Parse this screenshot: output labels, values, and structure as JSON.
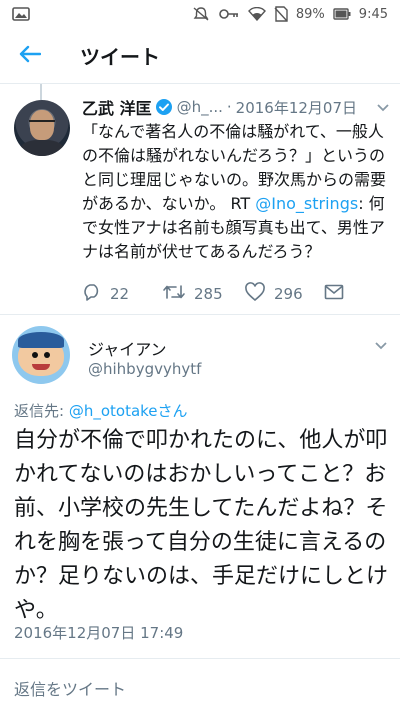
{
  "status_bar": {
    "battery": "89%",
    "time": "9:45",
    "icons": [
      "image-icon",
      "mute-icon",
      "key-icon",
      "wifi-icon",
      "no-sim-icon",
      "battery-icon"
    ]
  },
  "app_bar": {
    "title": "ツイート"
  },
  "parent_tweet": {
    "name": "乙武 洋匡",
    "handle": "@h_...",
    "separator": "·",
    "date": "2016年12月07日",
    "text_part1": "「なんで著名人の不倫は騒がれて、一般人の不倫は騒がれないんだろう？」というのと同じ理屈じゃないの。野次馬からの需要があるか、ないか。 RT ",
    "mention": "@Ino_strings",
    "text_part2": ": 何で女性アナは名前も顔写真も出て、男性アナは名前が伏せてあるんだろう？",
    "reply_count": "22",
    "retweet_count": "285",
    "like_count": "296"
  },
  "main_tweet": {
    "name": "ジャイアン",
    "handle": "@hihbygvyhytf",
    "reply_prefix": "返信先: ",
    "reply_mention": "@h_ototakeさん",
    "text": "自分が不倫で叩かれたのに、他人が叩かれてないのはおかしいってこと？お前、小学校の先生してたんだよね？それを胸を張って自分の生徒に言えるのか？足りないのは、手足だけにしとけや。",
    "date": "2016年12月07日 17:49"
  },
  "reply_composer": {
    "placeholder": "返信をツイート"
  },
  "colors": {
    "accent": "#1da1f2",
    "secondary_text": "#657786",
    "divider": "#e6ecf0"
  }
}
